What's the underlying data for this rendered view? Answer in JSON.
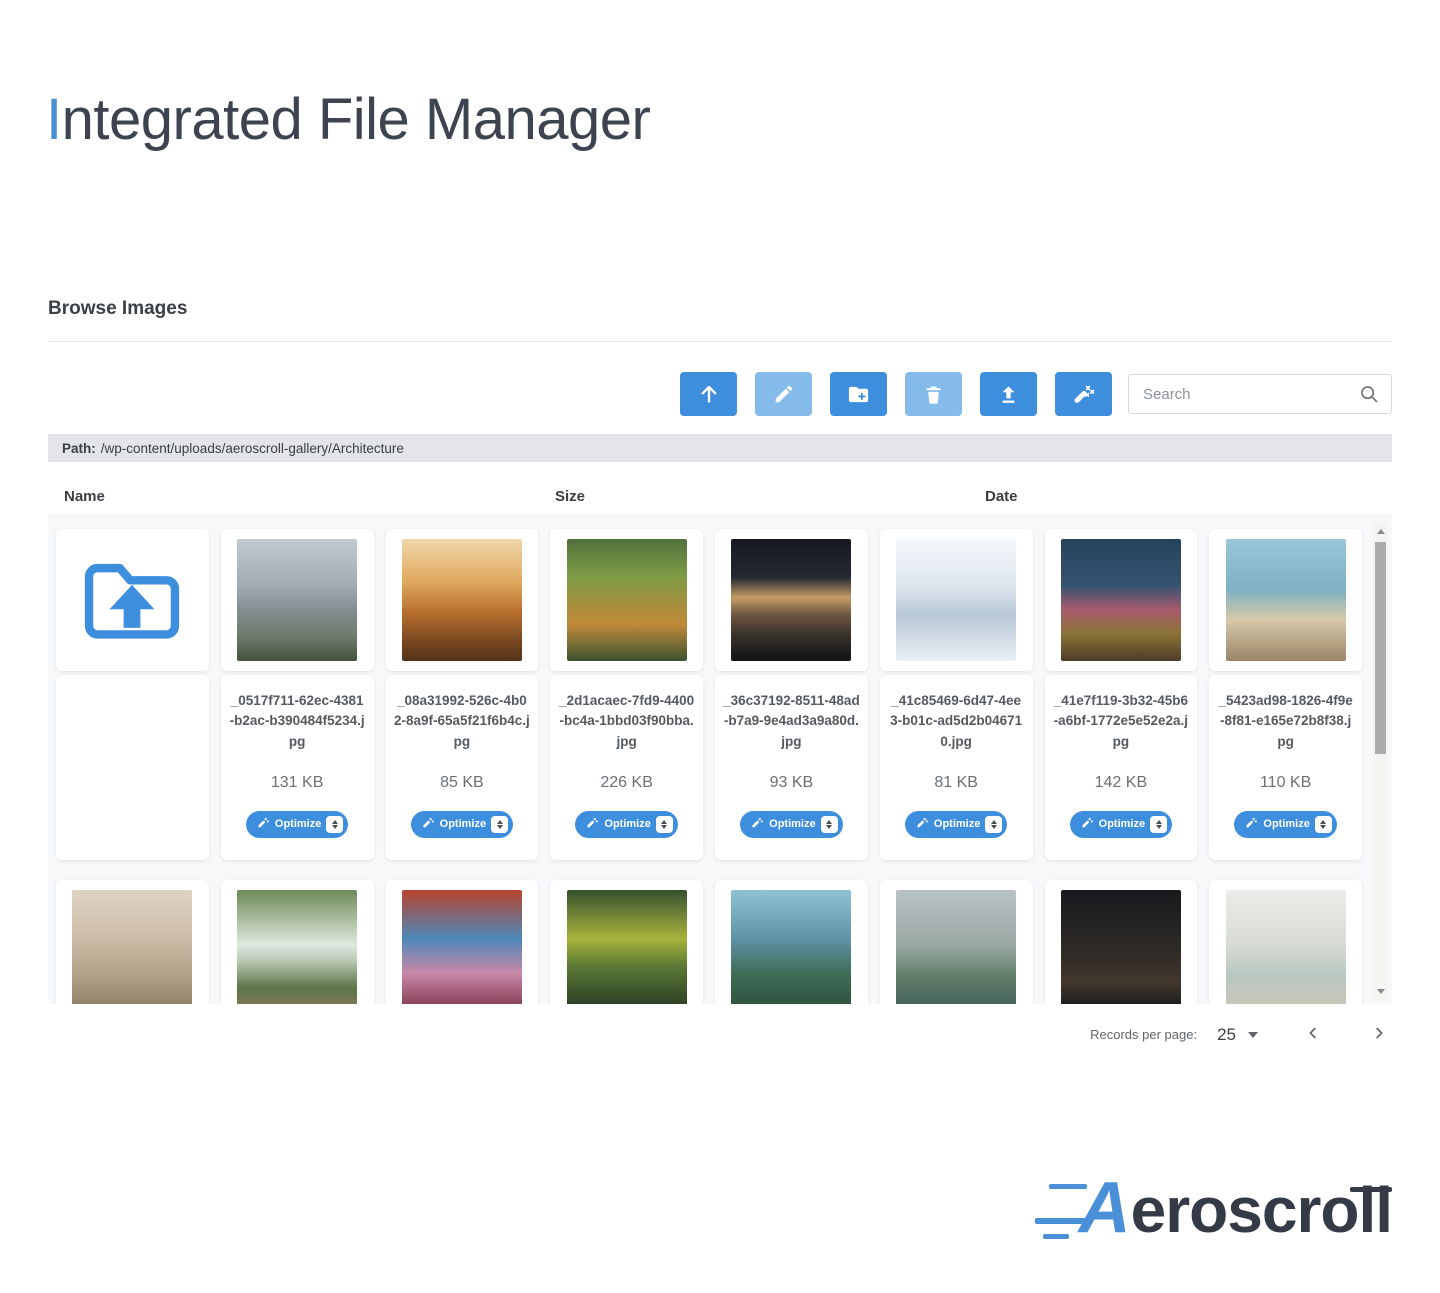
{
  "page": {
    "title_first": "I",
    "title_rest": "ntegrated File Manager"
  },
  "panel": {
    "heading": "Browse Images",
    "toolbar": {
      "buttons": [
        {
          "name": "navigate-up",
          "icon": "arrow-up-icon",
          "enabled": true
        },
        {
          "name": "rename",
          "icon": "pencil-icon",
          "enabled": false
        },
        {
          "name": "new-folder",
          "icon": "folder-plus-icon",
          "enabled": true
        },
        {
          "name": "delete",
          "icon": "trash-icon",
          "enabled": false
        },
        {
          "name": "upload",
          "icon": "upload-icon",
          "enabled": true
        },
        {
          "name": "optimize-all",
          "icon": "magic-wand-icon",
          "enabled": true
        }
      ],
      "search_placeholder": "Search"
    },
    "path": {
      "label": "Path:",
      "value": "/wp-content/uploads/aeroscroll-gallery/Architecture"
    },
    "columns": {
      "name": "Name",
      "size": "Size",
      "date": "Date"
    },
    "folder_up": {
      "icon": "folder-up-icon"
    },
    "optimize_label": "Optimize",
    "files": [
      {
        "name": "_0517f711-62ec-4381-b2ac-b390484f5234.jpg",
        "size": "131 KB",
        "thumb": "concrete-modern-house"
      },
      {
        "name": "_08a31992-526c-4b02-8a9f-65a5f21f6b4c.jpg",
        "size": "85 KB",
        "thumb": "sunset-cliff-house"
      },
      {
        "name": "_2d1acaec-7fd9-4400-bc4a-1bbd03f90bba.jpg",
        "size": "226 KB",
        "thumb": "green-roof-house"
      },
      {
        "name": "_36c37192-8511-48ad-b7a9-9e4ad3a9a80d.jpg",
        "size": "93 KB",
        "thumb": "dark-lit-house"
      },
      {
        "name": "_41c85469-6d47-4ee3-b01c-ad5d2b046710.jpg",
        "size": "81 KB",
        "thumb": "snow-house"
      },
      {
        "name": "_41e7f119-3b32-45b6-a6bf-1772e5e52e2a.jpg",
        "size": "142 KB",
        "thumb": "blue-eclectic-room"
      },
      {
        "name": "_5423ad98-1826-4f9e-8f81-e165e72b8f38.jpg",
        "size": "110 KB",
        "thumb": "beach-living-room"
      }
    ],
    "partial_row_thumbs": [
      "luxury-beige-living-room",
      "indoor-waterfall-wall",
      "stained-glass-red-sofa",
      "jungle-yellow-roof-house",
      "glass-dome-jungle",
      "rain-courtyard-house",
      "dark-bedroom",
      "pastel-living-room"
    ],
    "pagination": {
      "label": "Records per page:",
      "value": "25"
    }
  },
  "logo": {
    "first": "A",
    "rest": "eroscro",
    "tail": "ll"
  },
  "colors": {
    "accent": "#3e8ede",
    "accent_disabled": "#85bbea",
    "title_accent": "#4a90d9",
    "path_bg": "#e3e5e8"
  }
}
